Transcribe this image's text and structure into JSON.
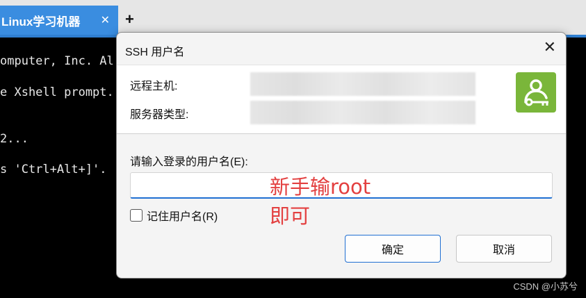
{
  "tabbar": {
    "tab_title": "Linux学习机器",
    "tab_close": "✕",
    "new_tab": "+"
  },
  "terminal": {
    "lines": [
      "omputer, Inc. Al",
      "e Xshell prompt.",
      "2...",
      "s 'Ctrl+Alt+]'."
    ]
  },
  "dialog": {
    "title": "SSH 用户名",
    "close": "✕",
    "remote_host_label": "远程主机:",
    "server_type_label": "服务器类型:",
    "prompt": "请输入登录的用户名(E):",
    "username_value": "",
    "remember_label": "记住用户名(R)",
    "remember_checked": false,
    "ok_label": "确定",
    "cancel_label": "取消",
    "logo_icon": "user-key-icon",
    "logo_color": "#7ab63a"
  },
  "annotations": {
    "line1": "新手输root",
    "line2": "即可",
    "color": "#e34040"
  },
  "watermark": "CSDN @小苏兮"
}
